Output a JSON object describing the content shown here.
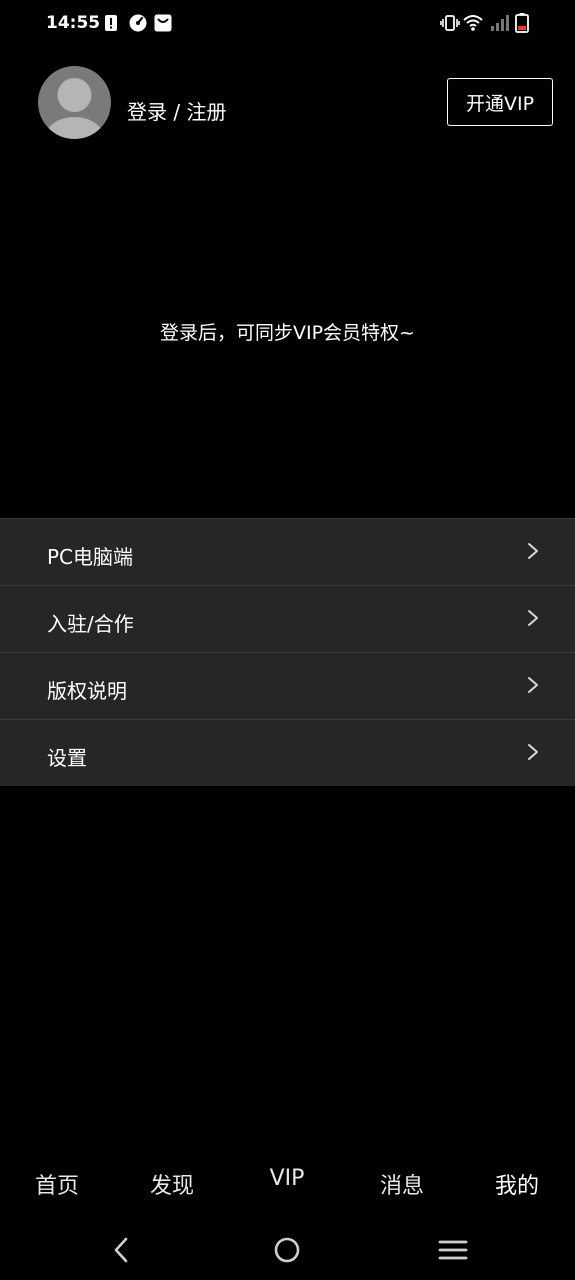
{
  "status_bar": {
    "time": "14:55",
    "left_icons": [
      "alert-icon",
      "speedometer-icon",
      "shopping-bag-icon"
    ],
    "right_icons": [
      "vibrate-icon",
      "wifi-icon",
      "signal-icon",
      "battery-icon"
    ]
  },
  "profile": {
    "login_label": "登录 / 注册",
    "vip_button_label": "开通VIP"
  },
  "hint": "登录后，可同步VIP会员特权~",
  "menu": {
    "items": [
      {
        "label": "PC电脑端"
      },
      {
        "label": "入驻/合作"
      },
      {
        "label": "版权说明"
      },
      {
        "label": "设置"
      }
    ]
  },
  "tabbar": {
    "tabs": [
      {
        "label": "首页"
      },
      {
        "label": "发现"
      },
      {
        "label": "VIP"
      },
      {
        "label": "消息"
      },
      {
        "label": "我的"
      }
    ],
    "active": "我的"
  },
  "colors": {
    "background": "#000000",
    "menu_item_bg": "#262626",
    "text": "#ffffff"
  }
}
